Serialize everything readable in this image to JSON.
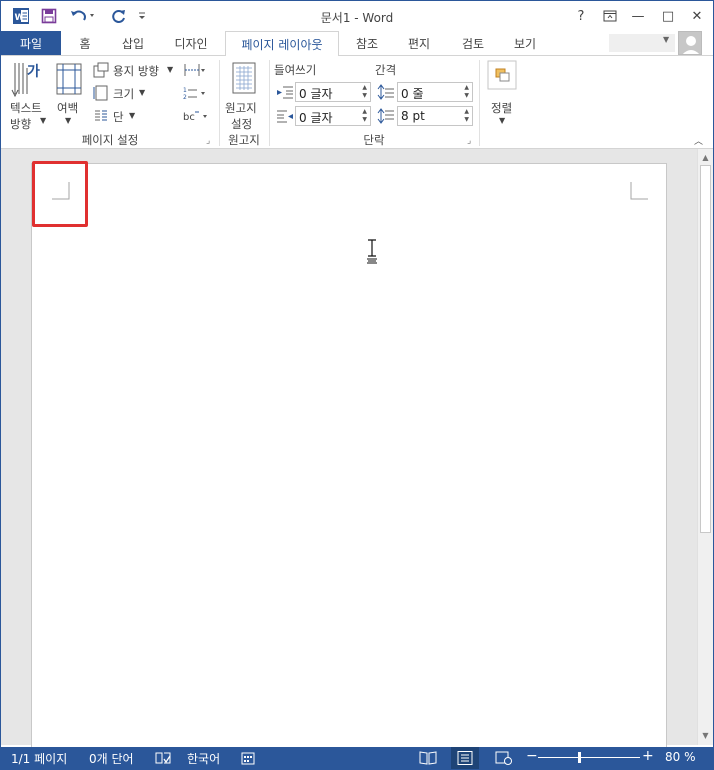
{
  "window": {
    "title": "문서1 - Word",
    "help": "?",
    "ribbon_display": "⧉",
    "minimize": "—",
    "maximize": "□",
    "close": "✕"
  },
  "quick_access": {
    "app_icon": "word-logo-icon",
    "save": "save-icon",
    "undo": "undo-icon",
    "redo": "redo-icon",
    "customize": "customize-icon"
  },
  "tabs": {
    "file": "파일",
    "items": [
      "홈",
      "삽입",
      "디자인",
      "페이지 레이아웃",
      "참조",
      "편지",
      "검토",
      "보기"
    ],
    "active": "페이지 레이아웃"
  },
  "ribbon": {
    "page_setup": {
      "text_direction_icon_text": "가",
      "text_direction_line1": "텍스트",
      "text_direction_line2": "방향",
      "margins": "여백",
      "orientation": "용지 방향",
      "size": "크기",
      "columns": "단",
      "group_label": "페이지 설정"
    },
    "manuscript": {
      "line1": "원고지",
      "line2": "설정",
      "group_label": "원고지"
    },
    "paragraph": {
      "indent_label": "들여쓰기",
      "spacing_label": "간격",
      "indent_left": "0 글자",
      "indent_right": "0 글자",
      "spacing_before": "0 줄",
      "spacing_after": "8 pt",
      "group_label": "단락"
    },
    "arrange": {
      "label": "정렬"
    }
  },
  "status": {
    "page": "1/1 페이지",
    "words": "0개 단어",
    "language": "한국어",
    "zoom": "80 %",
    "zoom_fraction": 0.4,
    "minus": "−",
    "plus": "+"
  },
  "colors": {
    "accent": "#2b579a",
    "highlight": "#e03030"
  }
}
